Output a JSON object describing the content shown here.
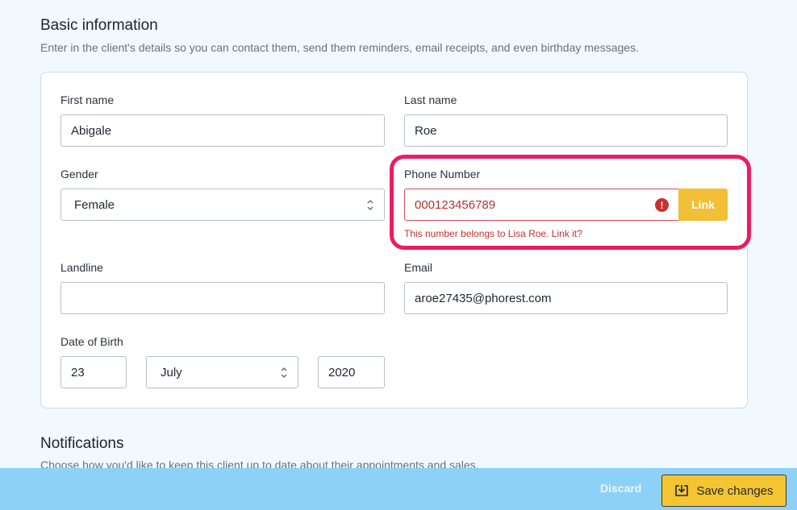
{
  "basic_info": {
    "title": "Basic information",
    "description": "Enter in the client's details so you can contact them, send them reminders, email receipts, and even birthday messages."
  },
  "form": {
    "first_name": {
      "label": "First name",
      "value": "Abigale"
    },
    "last_name": {
      "label": "Last name",
      "value": "Roe"
    },
    "gender": {
      "label": "Gender",
      "value": "Female"
    },
    "phone": {
      "label": "Phone Number",
      "value": "000123456789",
      "error": "This number belongs to Lisa Roe. Link it?",
      "link_label": "Link",
      "error_icon": "exclamation-circle-icon"
    },
    "landline": {
      "label": "Landline",
      "value": ""
    },
    "email": {
      "label": "Email",
      "value": "aroe27435@phorest.com"
    },
    "dob": {
      "label": "Date of Birth",
      "day": "23",
      "month": "July",
      "year": "2020"
    }
  },
  "notifications": {
    "title": "Notifications",
    "description": "Choose how you'd like to keep this client up to date about their appointments and sales."
  },
  "footer": {
    "discard_label": "Discard",
    "save_label": "Save changes",
    "save_icon": "save-tray-icon"
  },
  "colors": {
    "accent": "#f2bf36",
    "error": "#c8302f",
    "highlight": "#ee1b63",
    "footer_bg": "#8ed1f6"
  }
}
